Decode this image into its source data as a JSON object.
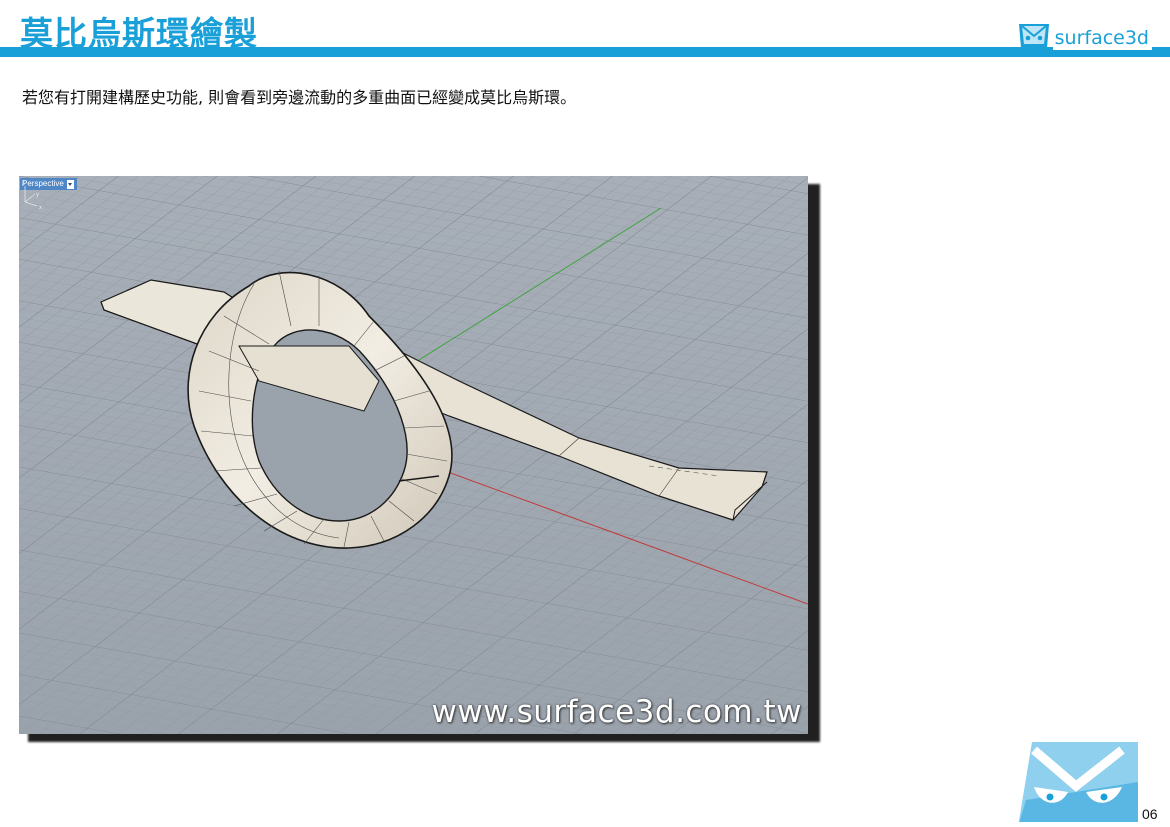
{
  "header": {
    "title": "莫比烏斯環繪製",
    "brand_name": "surface3d",
    "accent_color": "#1aa0d8"
  },
  "body": {
    "paragraph": "若您有打開建構歷史功能, 則會看到旁邊流動的多重曲面已經變成莫比烏斯環。"
  },
  "viewport": {
    "label": "Perspective",
    "watermark": "www.surface3d.com.tw",
    "axis_x": "x",
    "axis_y": "y",
    "axis_z": "z",
    "background_color": "#9aa2ac",
    "grid_color": "#8a929c",
    "x_axis_color": "#c23a3a",
    "y_axis_color": "#3fa33f",
    "surface_color": "#ece7dc",
    "icons": [
      "dropdown-arrow-icon"
    ]
  },
  "footer": {
    "page_number": "06",
    "logo_icon": "surface3d-mascot-logo"
  }
}
